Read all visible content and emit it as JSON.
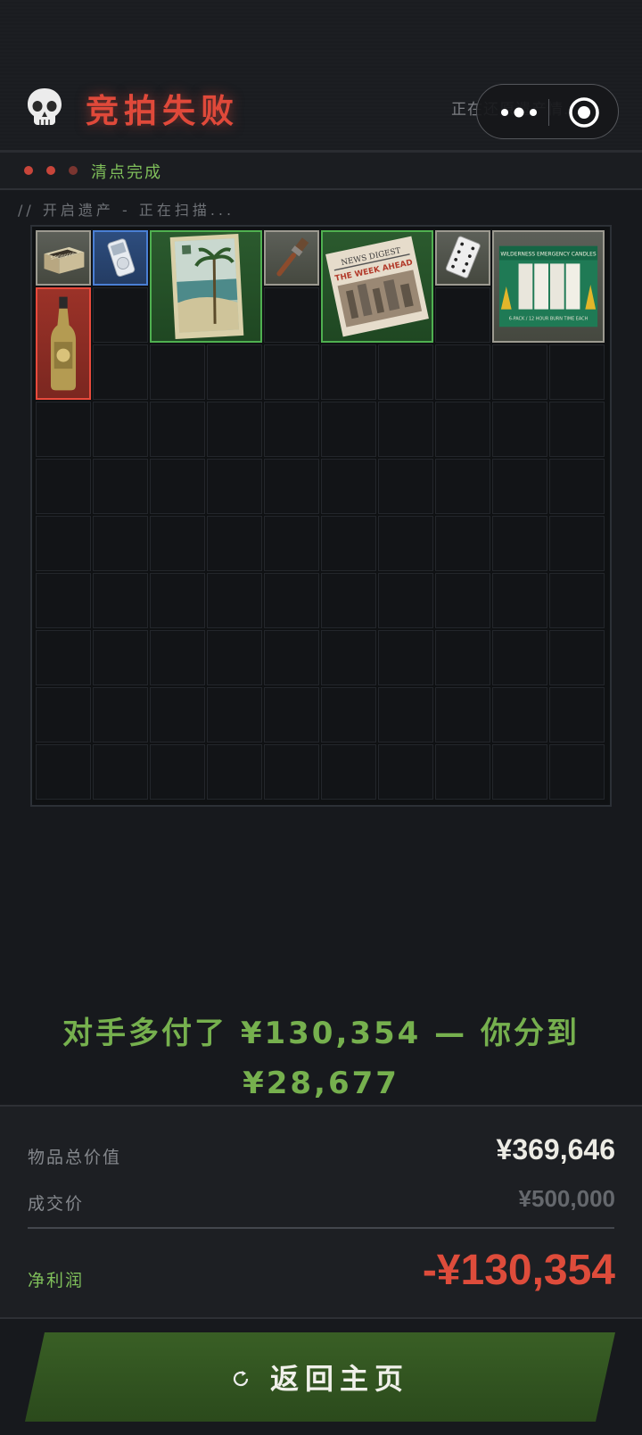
{
  "header": {
    "skull_icon": "skull-icon",
    "title": "竞拍失败",
    "restore_text": "正在还原遗产情...",
    "capsule": {
      "more_icon": "more-dots-icon",
      "close_icon": "target-close-icon"
    },
    "colors": {
      "title": "#e0493a",
      "accent_green": "#7fbf5a"
    }
  },
  "status": {
    "dots": [
      "#c8453a",
      "#c8453a",
      "#7a3530"
    ],
    "text": "清点完成"
  },
  "scan_text": "// 开启遗产 - 正在扫描...",
  "grid": {
    "columns": 10,
    "rows": 10,
    "items": [
      {
        "name": "cardboard-box",
        "rarity": "white",
        "col": 0,
        "row": 0,
        "w": 1,
        "h": 1
      },
      {
        "name": "handheld-device",
        "rarity": "blue",
        "col": 1,
        "row": 0,
        "w": 1,
        "h": 1
      },
      {
        "name": "tropical-postcard",
        "rarity": "green",
        "col": 2,
        "row": 0,
        "w": 2,
        "h": 2
      },
      {
        "name": "paint-brush",
        "rarity": "white",
        "col": 4,
        "row": 0,
        "w": 1,
        "h": 1
      },
      {
        "name": "newspaper",
        "rarity": "green",
        "col": 5,
        "row": 0,
        "w": 2,
        "h": 2
      },
      {
        "name": "playing-card",
        "rarity": "white",
        "col": 7,
        "row": 0,
        "w": 1,
        "h": 1
      },
      {
        "name": "candle-box",
        "rarity": "white",
        "col": 8,
        "row": 0,
        "w": 2,
        "h": 2
      },
      {
        "name": "champagne-bottle",
        "rarity": "red",
        "col": 0,
        "row": 1,
        "w": 1,
        "h": 2
      }
    ],
    "item_text": {
      "box_label": "S.Pellegrino",
      "newspaper_masthead": "NEWS DIGEST",
      "newspaper_headline": "THE WEEK AHEAD",
      "candle_title": "WILDERNESS EMERGENCY CANDLES",
      "candle_sub": "6-PACK / 12 HOUR BURN TIME EACH"
    }
  },
  "summary": {
    "line1": "对手多付了 ¥130,354 — 你分到",
    "line2": "¥28,677"
  },
  "stats": {
    "total_label": "物品总价值",
    "total_value": "¥369,646",
    "deal_label": "成交价",
    "deal_value": "¥500,000",
    "profit_label": "净利润",
    "profit_value": "-¥130,354",
    "colors": {
      "profit": "#de4c3b",
      "label_green": "#7fbf5a"
    }
  },
  "footer": {
    "return_icon": "refresh-icon",
    "return_label": "返回主页"
  }
}
